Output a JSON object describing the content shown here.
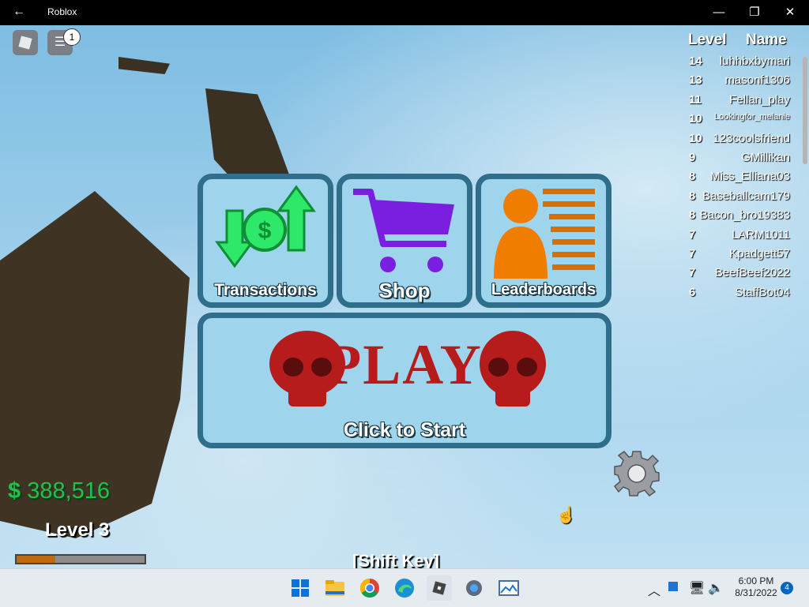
{
  "window": {
    "title": "Roblox",
    "back_glyph": "←",
    "minimize_glyph": "—",
    "restore_glyph": "❐",
    "close_glyph": "✕"
  },
  "topbar": {
    "chat_badge": "1"
  },
  "leaderboard": {
    "header_level": "Level",
    "header_name": "Name",
    "rows": [
      {
        "level": "14",
        "name": "luhhbxbymari"
      },
      {
        "level": "13",
        "name": "masonf1306"
      },
      {
        "level": "11",
        "name": "Fellan_play"
      },
      {
        "level": "10",
        "name": "Lookingfor_melanie"
      },
      {
        "level": "10",
        "name": "123coolsfriend"
      },
      {
        "level": "9",
        "name": "GMillikan"
      },
      {
        "level": "8",
        "name": "Miss_Elliana03"
      },
      {
        "level": "8",
        "name": "Baseballcam179"
      },
      {
        "level": "8",
        "name": "Bacon_bro19383"
      },
      {
        "level": "7",
        "name": "LARM1011"
      },
      {
        "level": "7",
        "name": "Kpadgett57"
      },
      {
        "level": "7",
        "name": "BeefBeef2022"
      },
      {
        "level": "6",
        "name": "StaffBot04"
      }
    ]
  },
  "menu": {
    "transactions": {
      "label": "Transactions",
      "icon": "money-transfer-icon"
    },
    "shop": {
      "label": "Shop",
      "icon": "shopping-cart-icon"
    },
    "leaderboards": {
      "label": "Leaderboards",
      "icon": "person-list-icon"
    },
    "play": {
      "title": "PLAY",
      "subtitle": "Click to Start",
      "icon": "skull-icon"
    }
  },
  "hud": {
    "currency_symbol": "$",
    "money": "388,516",
    "level_label": "Level 3",
    "xp_progress": 0.3,
    "shift_hint": "[Shift Key]",
    "settings_icon": "gear-icon"
  },
  "taskbar": {
    "apps": [
      "start-icon",
      "file-explorer-icon",
      "chrome-icon",
      "edge-icon",
      "roblox-icon",
      "settings-icon",
      "photos-icon"
    ],
    "time": "6:00 PM",
    "date": "8/31/2022",
    "notification_count": "4"
  },
  "colors": {
    "money_green": "#22c04a",
    "tile_border": "#2f6f8c",
    "tile_fill": "#9ed4ec",
    "play_red": "#b71c1c",
    "shop_purple": "#7a1fe0",
    "leader_orange": "#f07d00"
  }
}
